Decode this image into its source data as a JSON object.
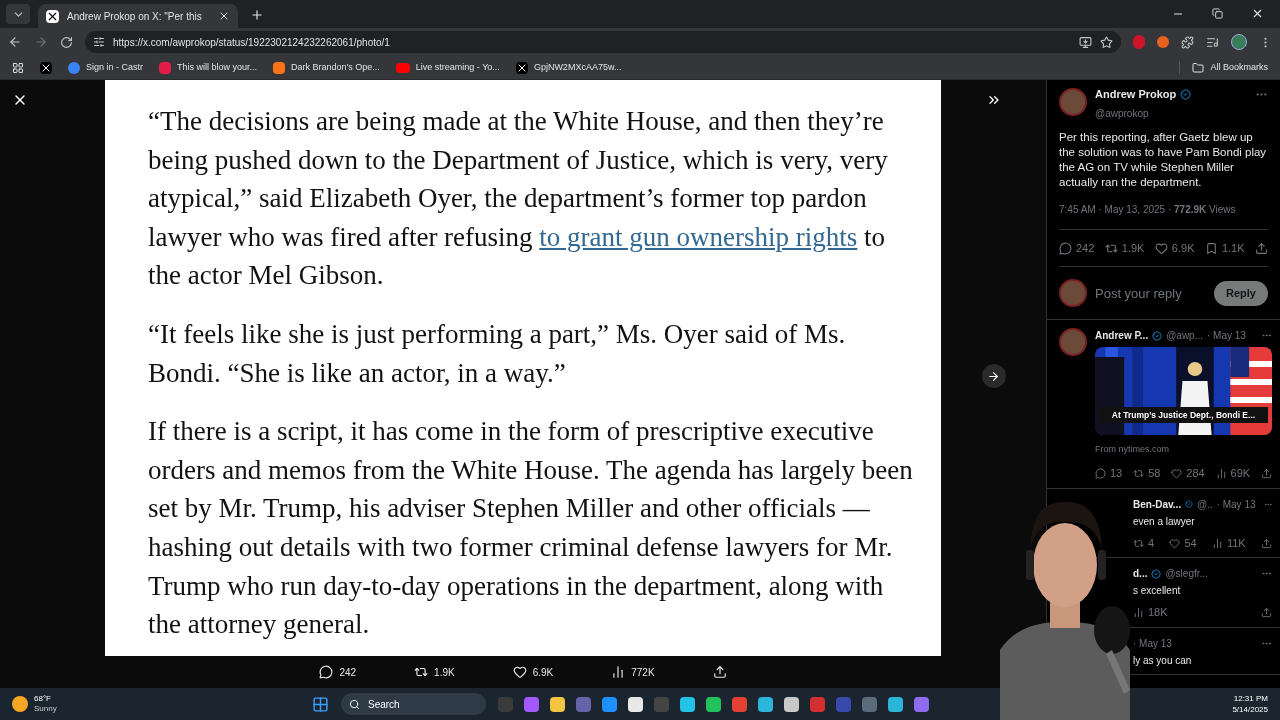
{
  "browser": {
    "tab_title": "Andrew Prokop on X: \"Per this",
    "url": "https://x.com/awprokop/status/1922302124232262061/photo/1",
    "bookmarks": [
      {
        "kind": "x"
      },
      {
        "kind": "castr",
        "label": "Sign in - Castr"
      },
      {
        "kind": "letter",
        "label": "This will blow your..."
      },
      {
        "kind": "orange",
        "label": "Dark Brandon's Ope..."
      },
      {
        "kind": "video",
        "label": "Live streaming - Yo..."
      },
      {
        "kind": "x",
        "label": "GpjNW2MXcAA75w..."
      }
    ],
    "all_bookmarks": "All Bookmarks"
  },
  "article": {
    "paragraphs": [
      [
        {
          "text": "“The decisions are being made at the White House, and then they’re being pushed down to the Department of Justice, which is very, very atypical,” said Elizabeth Oyer, the department’s former top pardon lawyer who was fired after refusing ",
          "link": false
        },
        {
          "text": "to grant gun ownership rights",
          "link": true
        },
        {
          "text": " to the actor Mel Gibson.",
          "link": false
        }
      ],
      [
        {
          "text": "“It feels like she is just performing a part,” Ms. Oyer said of Ms. Bondi. “She is like an actor, in a way.”",
          "link": false
        }
      ],
      [
        {
          "text": "If there is a script, it has come in the form of prescriptive executive orders and memos from the White House. The agenda has largely been set by Mr. Trump, his adviser Stephen Miller and other officials — hashing out details with two former criminal defense lawyers for Mr. Trump who run day-to-day operations in the department, along with the attorney general.",
          "link": false
        }
      ]
    ]
  },
  "photo_actions": [
    {
      "kind": "reply",
      "count": "242"
    },
    {
      "kind": "repost",
      "count": "1.9K"
    },
    {
      "kind": "like",
      "count": "6.9K"
    },
    {
      "kind": "views",
      "count": "772K"
    },
    {
      "kind": "share"
    }
  ],
  "tweet": {
    "author": "Andrew Prokop",
    "handle": "@awprokop",
    "text": "Per this reporting, after Gaetz blew up the solution was to have Pam Bondi play the AG on TV while Stephen Miller actually ran the department.",
    "meta": "7:45 AM · May 13, 2025 · **772.9K** Views",
    "actions": [
      {
        "kind": "reply",
        "count": "242"
      },
      {
        "kind": "repost",
        "count": "1.9K"
      },
      {
        "kind": "like",
        "count": "6.9K"
      },
      {
        "kind": "bookmark",
        "count": "1.1K"
      },
      {
        "kind": "share"
      }
    ],
    "reply_placeholder": "Post your reply",
    "reply_button": "Reply"
  },
  "replies": [
    {
      "name": "Andrew P...",
      "handle": "@awp...",
      "date": "· May 13",
      "card": {
        "caption": "At Trump’s Justice Dept., Bondi E...",
        "source": "From nytimes.com"
      },
      "actions": [
        {
          "kind": "reply",
          "count": "13"
        },
        {
          "kind": "repost",
          "count": "58"
        },
        {
          "kind": "like",
          "count": "284"
        },
        {
          "kind": "views",
          "count": "69K"
        },
        {
          "kind": "share"
        }
      ]
    },
    {
      "name": "Ben-Dav...",
      "handle": "@..",
      "date": "· May 13",
      "text": "even a lawyer",
      "actions": [
        {
          "kind": "repost",
          "count": "4"
        },
        {
          "kind": "like",
          "count": "54"
        },
        {
          "kind": "views",
          "count": "11K"
        },
        {
          "kind": "share"
        }
      ]
    },
    {
      "name": "d...",
      "handle": "@slegfr...",
      "text": "s excellent",
      "actions": [
        {
          "kind": "views",
          "count": "18K"
        },
        {
          "kind": "share"
        }
      ]
    },
    {
      "date": "· May 13",
      "text": "ly as you can"
    }
  ],
  "taskbar": {
    "temperature": "68°F",
    "weather": "Sunny",
    "search": "Search",
    "time": "12:31 PM",
    "date": "5/14/2025",
    "apps": [
      {
        "color": "#3a3a3a"
      },
      {
        "color": "#a259ff"
      },
      {
        "color": "#f4c542"
      },
      {
        "color": "#6264a7"
      },
      {
        "color": "#1e90ff"
      },
      {
        "color": "#e8e8e8"
      },
      {
        "color": "#444444"
      },
      {
        "color": "#22c3e6"
      },
      {
        "color": "#21c25e"
      },
      {
        "color": "#e34133"
      },
      {
        "color": "#2bb5d8"
      },
      {
        "color": "#c8c8c8"
      },
      {
        "color": "#d32f2f"
      },
      {
        "color": "#3949ab"
      },
      {
        "color": "#5a6b7b"
      },
      {
        "color": "#2bb5d8"
      },
      {
        "color": "#8e6bf0"
      }
    ]
  }
}
